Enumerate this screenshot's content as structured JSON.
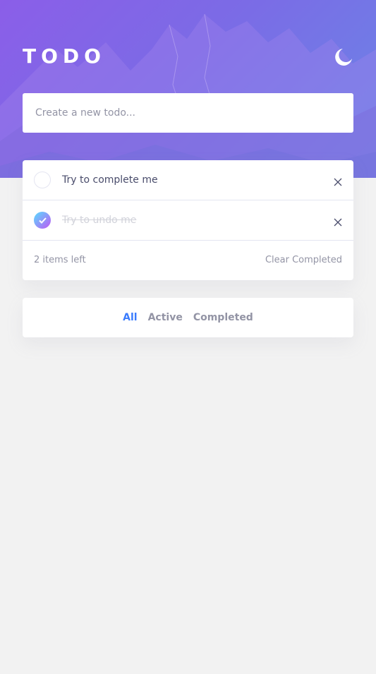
{
  "header": {
    "title": "TODO",
    "theme_toggle_icon": "moon-icon"
  },
  "new_todo": {
    "placeholder": "Create a new todo..."
  },
  "todos": [
    {
      "text": "Try to complete me",
      "completed": false
    },
    {
      "text": "Try to undo me",
      "completed": true
    }
  ],
  "footer": {
    "items_left": "2 items left",
    "clear_completed": "Clear Completed"
  },
  "filters": {
    "all": "All",
    "active": "Active",
    "completed": "Completed",
    "selected": "All"
  },
  "colors": {
    "accent": "#3a7bfd",
    "check_gradient_start": "#57ddff",
    "check_gradient_end": "#c058f3",
    "hero_gradient_start": "#8b5ee8",
    "hero_gradient_end": "#6a86e6"
  }
}
